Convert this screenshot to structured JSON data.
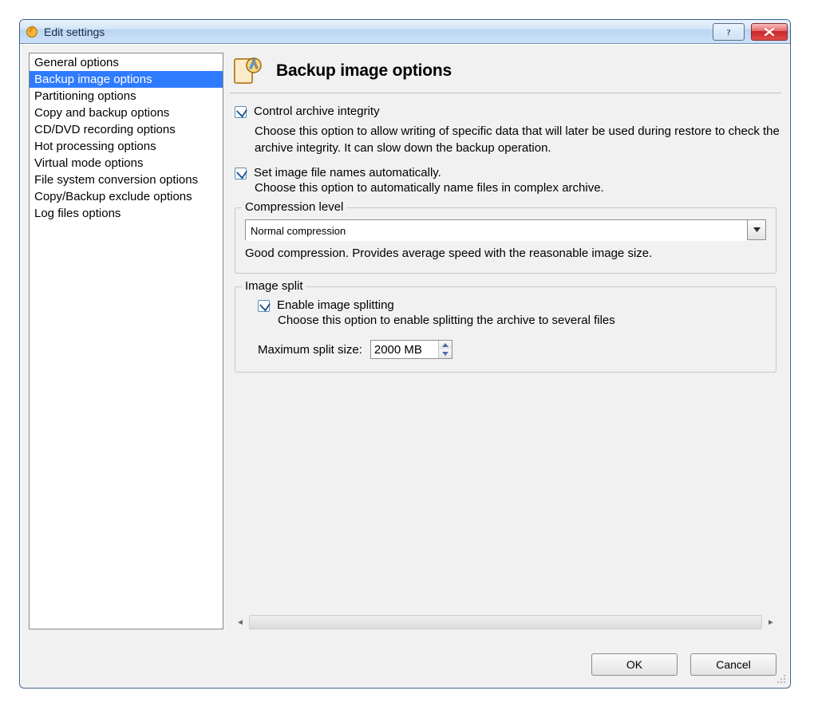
{
  "window": {
    "title": "Edit settings"
  },
  "titlebar": {
    "help_icon": "?",
    "close_icon": "×"
  },
  "sidebar": {
    "items": [
      {
        "label": "General options",
        "selected": false
      },
      {
        "label": "Backup image options",
        "selected": true
      },
      {
        "label": "Partitioning options",
        "selected": false
      },
      {
        "label": "Copy and backup options",
        "selected": false
      },
      {
        "label": "CD/DVD recording options",
        "selected": false
      },
      {
        "label": "Hot processing options",
        "selected": false
      },
      {
        "label": "Virtual mode options",
        "selected": false
      },
      {
        "label": "File system conversion options",
        "selected": false
      },
      {
        "label": "Copy/Backup exclude options",
        "selected": false
      },
      {
        "label": "Log files options",
        "selected": false
      }
    ]
  },
  "page": {
    "title": "Backup image options",
    "options": {
      "control_integrity": {
        "checked": true,
        "label": "Control archive integrity",
        "desc": "Choose this option to allow writing of specific data that will later be used during restore to check the archive integrity. It can slow down the backup operation."
      },
      "auto_names": {
        "checked": true,
        "label": "Set image file names automatically.",
        "desc": "Choose this option to automatically name files in complex archive."
      }
    },
    "compression": {
      "group_title": "Compression level",
      "value": "Normal compression",
      "hint": "Good compression. Provides average speed with the reasonable image size."
    },
    "split": {
      "group_title": "Image split",
      "enable": {
        "checked": true,
        "label": "Enable image splitting",
        "desc": "Choose this option to enable splitting the archive to several files"
      },
      "max_label": "Maximum split size:",
      "max_value": "2000 MB"
    }
  },
  "buttons": {
    "ok": "OK",
    "cancel": "Cancel"
  }
}
